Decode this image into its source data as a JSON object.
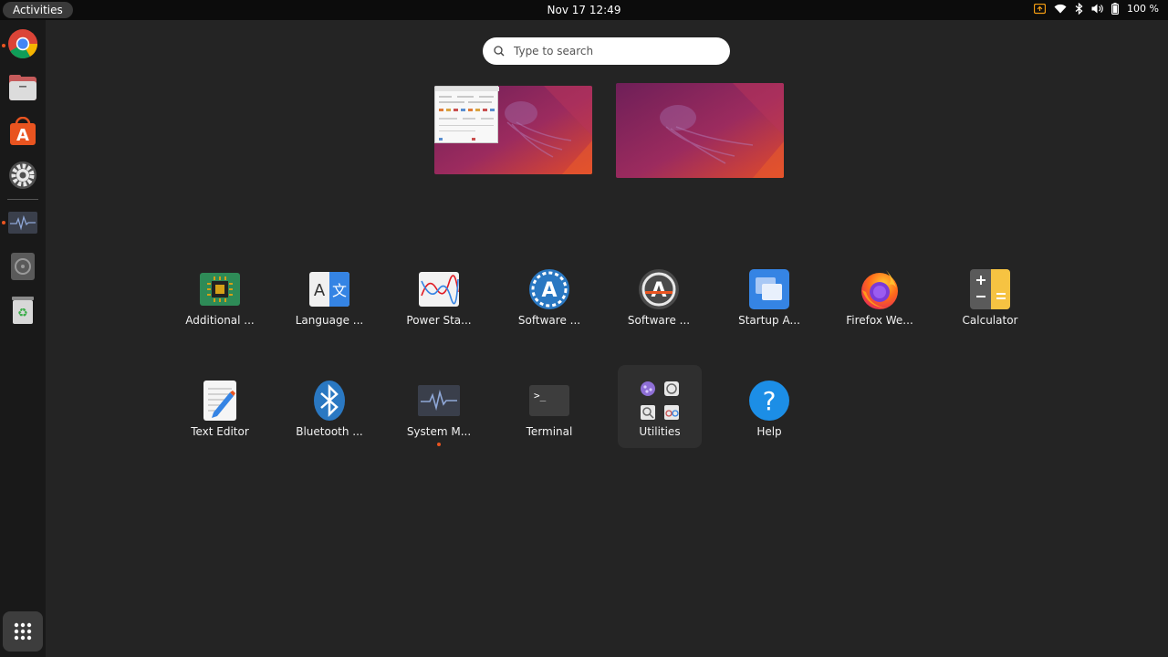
{
  "topbar": {
    "activities": "Activities",
    "datetime": "Nov 17  12:49",
    "battery": "100 %"
  },
  "dock": {
    "items": [
      "chrome-icon",
      "files-icon",
      "app-center-icon",
      "settings-icon",
      "system-monitor-icon",
      "disc-icon",
      "trash-icon"
    ],
    "show_apps": "app-grid-icon"
  },
  "search": {
    "placeholder": "Type to search"
  },
  "apps": {
    "row1": [
      {
        "label": "Additional ..."
      },
      {
        "label": "Language ..."
      },
      {
        "label": "Power Sta..."
      },
      {
        "label": "Software ..."
      },
      {
        "label": "Software ..."
      },
      {
        "label": "Startup A..."
      },
      {
        "label": "Firefox We..."
      },
      {
        "label": "Calculator"
      }
    ],
    "row2": [
      {
        "label": "Text Editor"
      },
      {
        "label": "Bluetooth ..."
      },
      {
        "label": "System M..."
      },
      {
        "label": "Terminal"
      },
      {
        "label": "Utilities"
      },
      {
        "label": "Help"
      }
    ]
  },
  "colors": {
    "accent": "#e95420",
    "background": "#242424",
    "topbar": "#0c0c0c",
    "dock": "#191919"
  }
}
